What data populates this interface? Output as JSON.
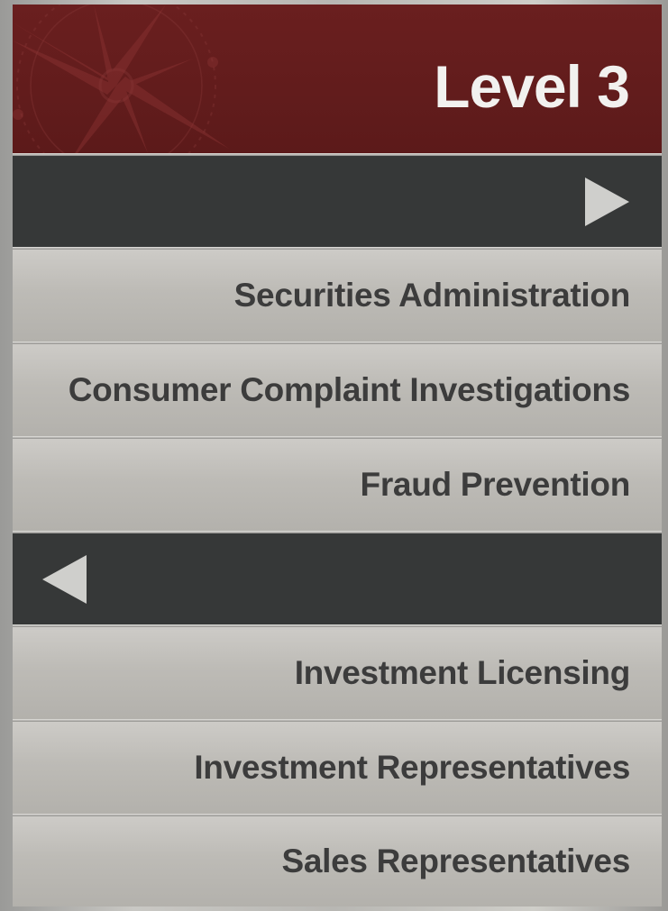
{
  "header": {
    "title": "Level 3",
    "color": "#5c1a1a"
  },
  "sections": [
    {
      "direction": "right",
      "icon": "arrow-right-icon",
      "items": [
        "Securities Administration",
        "Consumer Complaint Investigations",
        "Fraud Prevention"
      ]
    },
    {
      "direction": "left",
      "icon": "arrow-left-icon",
      "items": [
        "Investment Licensing",
        "Investment Representatives",
        "Sales Representatives"
      ]
    }
  ]
}
